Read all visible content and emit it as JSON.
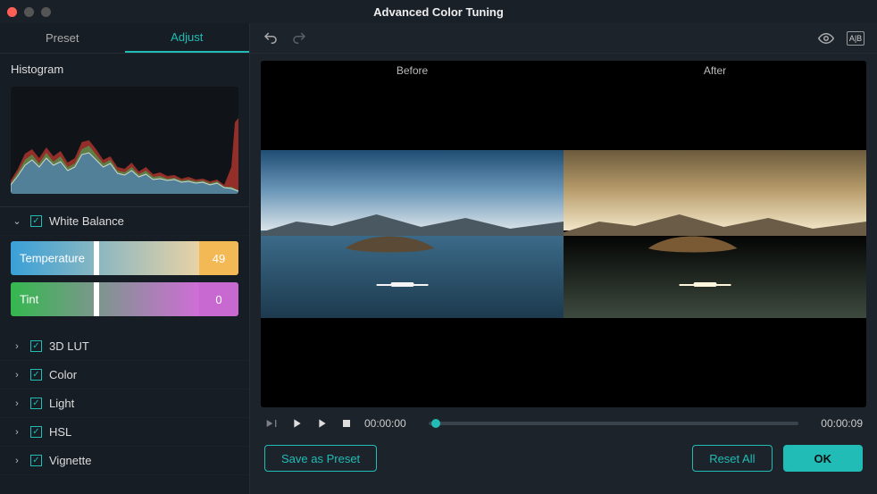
{
  "window": {
    "title": "Advanced Color Tuning"
  },
  "tabs": {
    "preset": "Preset",
    "adjust": "Adjust",
    "active": "adjust"
  },
  "histogram": {
    "label": "Histogram"
  },
  "sections": {
    "white_balance": {
      "label": "White Balance",
      "expanded": true,
      "enabled": true
    },
    "sliders": {
      "temperature": {
        "label": "Temperature",
        "value": 49,
        "handle_pct": 44
      },
      "tint": {
        "label": "Tint",
        "value": 0,
        "handle_pct": 44
      }
    },
    "lut": {
      "label": "3D LUT",
      "expanded": false,
      "enabled": true
    },
    "color": {
      "label": "Color",
      "expanded": false,
      "enabled": true
    },
    "light": {
      "label": "Light",
      "expanded": false,
      "enabled": true
    },
    "hsl": {
      "label": "HSL",
      "expanded": false,
      "enabled": true
    },
    "vignette": {
      "label": "Vignette",
      "expanded": false,
      "enabled": true
    }
  },
  "preview": {
    "before": "Before",
    "after": "After",
    "compare_label": "A|B"
  },
  "playback": {
    "current": "00:00:00",
    "total": "00:00:09",
    "cursor_pct": 2
  },
  "buttons": {
    "save_preset": "Save as Preset",
    "reset_all": "Reset All",
    "ok": "OK"
  }
}
